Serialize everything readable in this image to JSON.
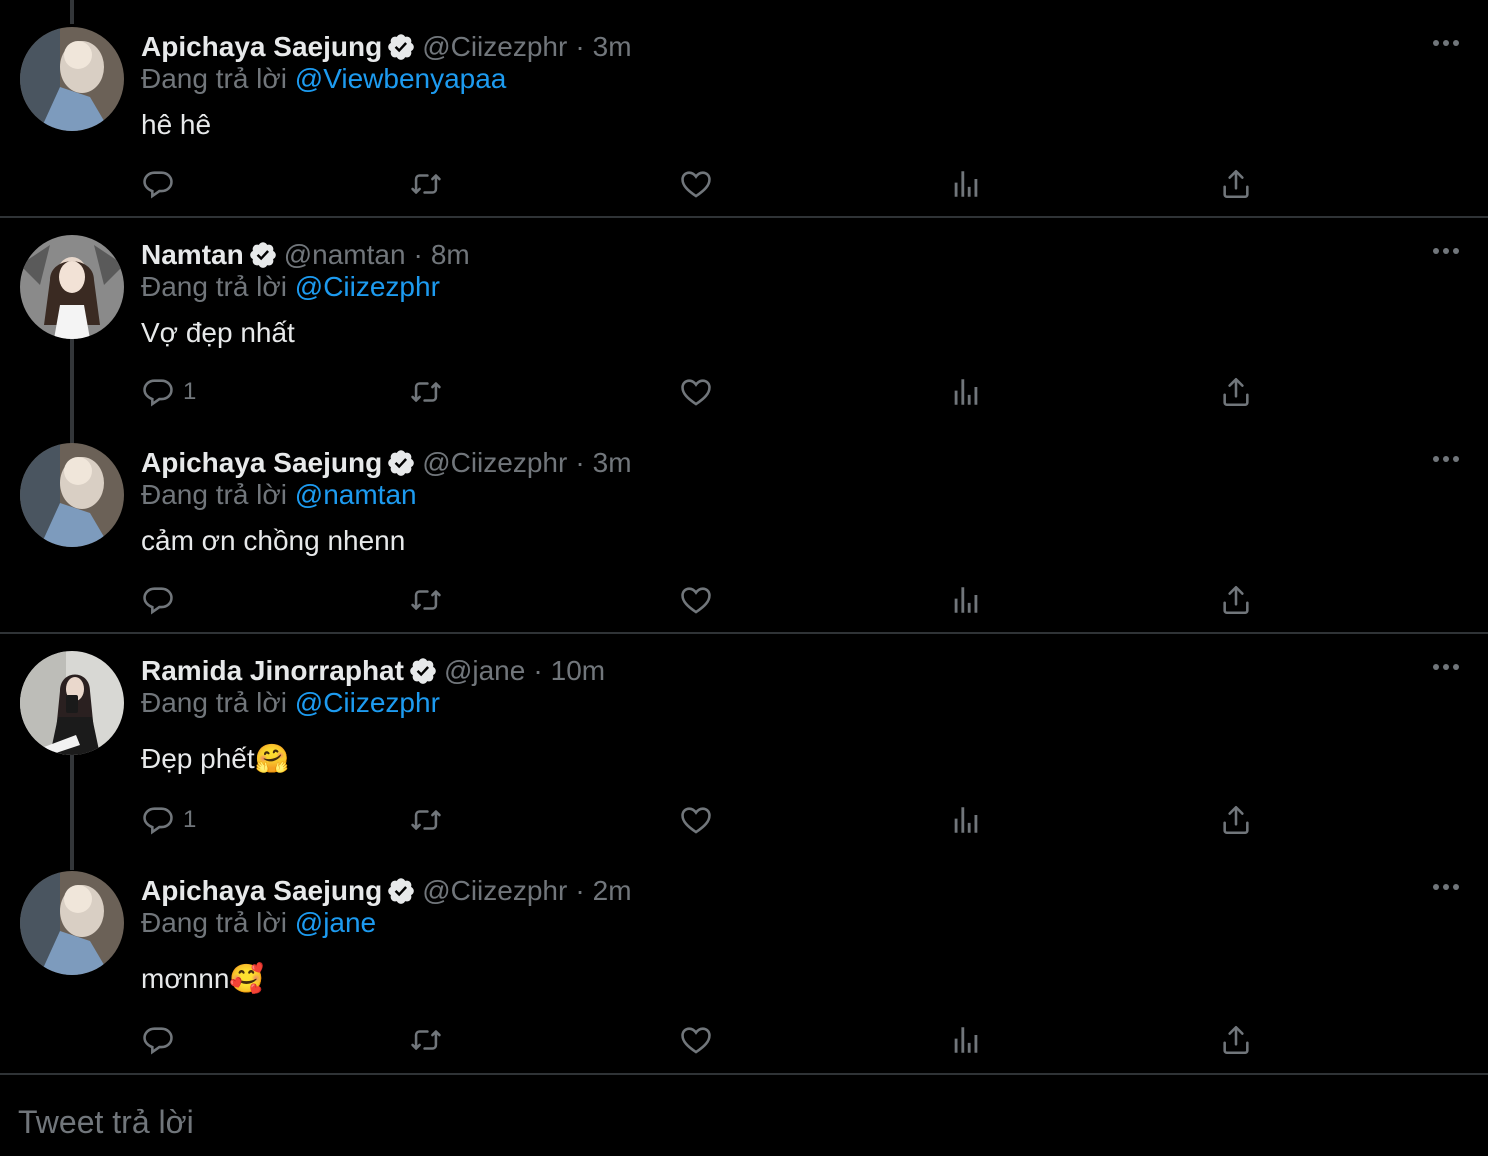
{
  "replying_prefix": "Đang trả lời",
  "compose_placeholder": "Tweet trả lời",
  "colors": {
    "background": "#000000",
    "text": "#e7e9ea",
    "muted": "#71767b",
    "link": "#1d9bf0",
    "divider": "#2f3336"
  },
  "tweets": [
    {
      "name": "Apichaya Saejung",
      "handle": "@Ciizezphr",
      "time": "3m",
      "replying_to": "@Viewbenyapaa",
      "text": "hê hê",
      "reply_count": ""
    },
    {
      "name": "Namtan",
      "handle": "@namtan",
      "time": "8m",
      "replying_to": "@Ciizezphr",
      "text": "Vợ đẹp nhất",
      "reply_count": "1"
    },
    {
      "name": "Apichaya Saejung",
      "handle": "@Ciizezphr",
      "time": "3m",
      "replying_to": "@namtan",
      "text": "cảm ơn chồng nhenn",
      "reply_count": ""
    },
    {
      "name": "Ramida Jinorraphat",
      "handle": "@jane",
      "time": "10m",
      "replying_to": "@Ciizezphr",
      "text": "Đẹp phết🤗",
      "reply_count": "1"
    },
    {
      "name": "Apichaya Saejung",
      "handle": "@Ciizezphr",
      "time": "2m",
      "replying_to": "@jane",
      "text": "mơnnn🥰",
      "reply_count": ""
    }
  ],
  "icons": [
    "verified-badge-icon",
    "more-icon",
    "reply-icon",
    "retweet-icon",
    "like-icon",
    "views-icon",
    "share-icon"
  ]
}
